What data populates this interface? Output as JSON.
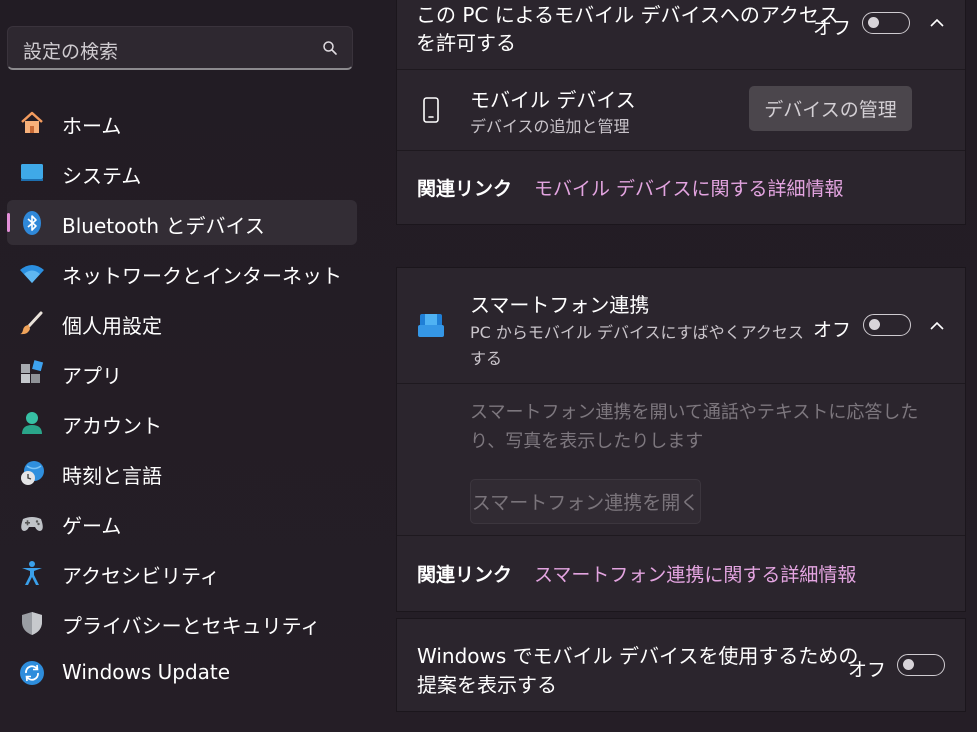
{
  "search": {
    "placeholder": "設定の検索",
    "icon": "search-icon"
  },
  "nav": [
    {
      "label": "ホーム",
      "icon": "home-icon",
      "active": false
    },
    {
      "label": "システム",
      "icon": "system-icon",
      "active": false
    },
    {
      "label": "Bluetooth とデバイス",
      "icon": "bluetooth-icon",
      "active": true
    },
    {
      "label": "ネットワークとインターネット",
      "icon": "wifi-icon",
      "active": false
    },
    {
      "label": "個人用設定",
      "icon": "brush-icon",
      "active": false
    },
    {
      "label": "アプリ",
      "icon": "apps-icon",
      "active": false
    },
    {
      "label": "アカウント",
      "icon": "account-icon",
      "active": false
    },
    {
      "label": "時刻と言語",
      "icon": "time-language-icon",
      "active": false
    },
    {
      "label": "ゲーム",
      "icon": "gamepad-icon",
      "active": false
    },
    {
      "label": "アクセシビリティ",
      "icon": "accessibility-icon",
      "active": false
    },
    {
      "label": "プライバシーとセキュリティ",
      "icon": "shield-icon",
      "active": false
    },
    {
      "label": "Windows Update",
      "icon": "windows-update-icon",
      "active": false
    }
  ],
  "mobile_access": {
    "line1": "この PC によるモバイル デバイスへのアクセス",
    "line2": "を許可する",
    "toggle_label": "オフ",
    "toggle_on": false
  },
  "mobile_devices": {
    "title": "モバイル デバイス",
    "subtitle": "デバイスの追加と管理",
    "button": "デバイスの管理",
    "icon": "phone-icon"
  },
  "related1": {
    "label": "関連リンク",
    "link": "モバイル デバイスに関する詳細情報"
  },
  "phone_link": {
    "title": "スマートフォン連携",
    "subtitle_line1": "PC からモバイル デバイスにすばやくアクセス",
    "subtitle_line2": "する",
    "toggle_label": "オフ",
    "toggle_on": false,
    "icon": "phone-link-icon",
    "desc_line1": "スマートフォン連携を開いて通話やテキストに応答した",
    "desc_line2": "り、写真を表示したりします",
    "open_button": "スマートフォン連携を開く"
  },
  "related2": {
    "label": "関連リンク",
    "link": "スマートフォン連携に関する詳細情報"
  },
  "suggestions": {
    "line1": "Windows でモバイル デバイスを使用するための",
    "line2": "提案を表示する",
    "toggle_label": "オフ",
    "toggle_on": false
  },
  "colors": {
    "accent": "#e38fd8",
    "link": "#e3a4e0",
    "background": "#231d25",
    "card": "#2b252d"
  }
}
